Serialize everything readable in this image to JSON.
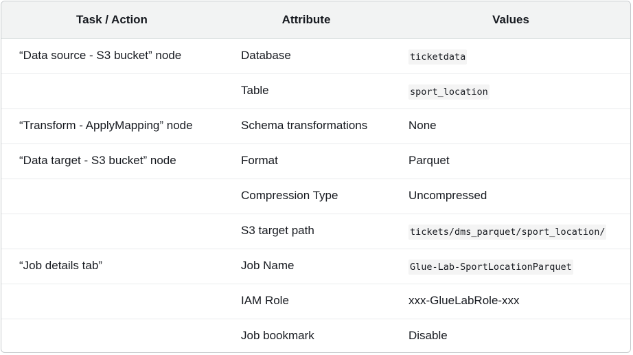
{
  "headers": {
    "task": "Task / Action",
    "attribute": "Attribute",
    "values": "Values"
  },
  "rows": [
    {
      "task": "“Data source - S3 bucket” node",
      "attribute": "Database",
      "value": "ticketdata",
      "mono": true
    },
    {
      "task": "",
      "attribute": "Table",
      "value": "sport_location",
      "mono": true
    },
    {
      "task": "“Transform - ApplyMapping” node",
      "attribute": "Schema transformations",
      "value": "None",
      "mono": false
    },
    {
      "task": "“Data target - S3 bucket” node",
      "attribute": "Format",
      "value": "Parquet",
      "mono": false
    },
    {
      "task": "",
      "attribute": "Compression Type",
      "value": "Uncompressed",
      "mono": false
    },
    {
      "task": "",
      "attribute": "S3 target path",
      "value": "tickets/dms_parquet/sport_location/",
      "mono": true
    },
    {
      "task": "“Job details tab”",
      "attribute": "Job Name",
      "value": "Glue-Lab-SportLocationParquet",
      "mono": true
    },
    {
      "task": "",
      "attribute": "IAM Role",
      "value": "xxx-GlueLabRole-xxx",
      "mono": false
    },
    {
      "task": "",
      "attribute": "Job bookmark",
      "value": "Disable",
      "mono": false
    }
  ]
}
